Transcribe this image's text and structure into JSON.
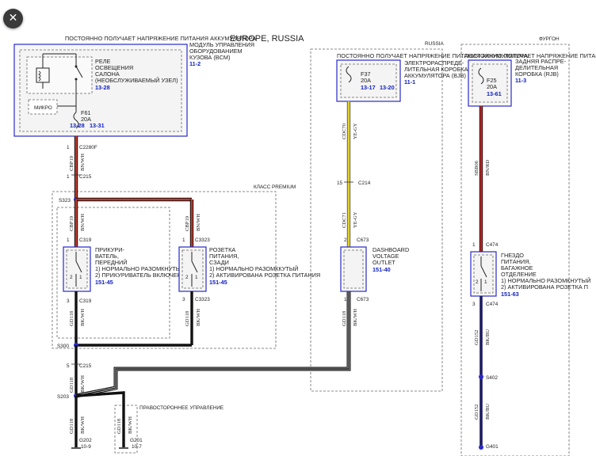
{
  "title": "EUROPE, RUSSIA",
  "close_icon": "x-close-icon",
  "headers": {
    "left_power": "ПОСТОЯННО ПОЛУЧАЕТ НАПРЯЖЕНИЕ ПИТАНИЯ АККУМУЛЯТОРА",
    "mid_power": "ПОСТОЯННО ПОЛУЧАЕТ НАПРЯЖЕНИЕ ПИТАНИЯ АККУМУЛЯТОРА",
    "right_power": "ПОСТОЯННО ПОЛУЧАЕТ НАПРЯЖЕНИЕ ПИТАНИЯ АККУМУЛЯТОРА",
    "russia": "RUSSIA",
    "van": "ФУРГОН",
    "premium": "КЛАСС PREMIUM",
    "rhd": "ПРАВОСТОРОННЕЕ УПРАВЛЕНИЕ"
  },
  "bcm": {
    "l1": "МОДУЛЬ УПРАВЛЕНИЯ",
    "l2": "ОБОРУДОВАНИЕМ",
    "l3": "КУЗОВА (BCM)",
    "ref": "11-2",
    "relay_l1": "РЕЛЕ",
    "relay_l2": "ОСВЕЩЕНИЯ",
    "relay_l3": "САЛОНА",
    "relay_l4": "(НЕОБСЛУЖИВАЕМЫЙ УЗЕЛ)",
    "relay_ref": "13-28",
    "micro": "МИКРО",
    "fuse": "F61",
    "amps": "20A",
    "ref_a": "13-28",
    "ref_b": "13-31"
  },
  "bjb": {
    "l1": "ЭЛЕКТРОРАСПРЕДЕ-",
    "l2": "ЛИТЕЛЬНАЯ КОРОБКА",
    "l3": "АККУМУЛЯТОРА (BJB)",
    "ref": "11-1",
    "fuse": "F37",
    "amps": "20A",
    "ref_a": "13-17",
    "ref_b": "13-20"
  },
  "rjb": {
    "l1": "ЗАДНЯЯ РАСПРЕ-",
    "l2": "ДЕЛИТЕЛЬНАЯ",
    "l3": "КОРОБКА (RJB)",
    "ref": "11-3",
    "fuse": "F25",
    "amps": "20A",
    "ref_a": "13-61"
  },
  "lighter": {
    "l1": "ПРИКУРИ-",
    "l2": "ВАТЕЛЬ,",
    "l3": "ПЕРЕДНИЙ",
    "s1": "1) НОРМАЛЬНО РАЗОМКНУТЫЙ",
    "s2": "2) ПРИКУРИВАТЕЛЬ ВКЛЮЧЕН",
    "ref": "151-45",
    "c_top": "C319",
    "c_bot": "C319",
    "pin_top": "1",
    "pin_bot": "3"
  },
  "rear_socket": {
    "l1": "РОЗЕТКА",
    "l2": "ПИТАНИЯ,",
    "l3": "СЗАДИ",
    "s1": "1) НОРМАЛЬНО РАЗОМККУТЫЙ",
    "s2": "2) АКТИВИРОВАНА РОЗЕТКА ПИТАНИЯ",
    "ref": "151-45",
    "c_top": "C3323",
    "c_bot": "C3323",
    "pin_top": "1",
    "pin_bot": "3"
  },
  "dash_outlet": {
    "l1": "DASHBOARD",
    "l2": "VOLTAGE",
    "l3": "OUTLET",
    "ref": "151-40",
    "c_top": "C673",
    "c_bot": "C673",
    "pin_top": "2",
    "pin_bot": "1"
  },
  "cargo_socket": {
    "l1": "ГНЕЗДО",
    "l2": "ПИТАНИЯ,",
    "l3": "БАГАЖНОЕ",
    "l4": "ОТДЕЛЕНИЕ",
    "s1": "1) НОРМАЛЬНО РАЗОМКНУТЫЙ",
    "s2": "2) АКТИВИРОВАНА РОЗЕТКА П",
    "ref": "151-63",
    "c_top": "C474",
    "c_bot": "C474",
    "pin_top": "1",
    "pin_bot": "3"
  },
  "connectors": {
    "c2280f": "C2280F",
    "c2280f_pin": "1",
    "c215_top": "C215",
    "c215_top_pin": "1",
    "c215_bot": "C215",
    "c215_bot_pin": "5",
    "c214": "C214",
    "c214_pin": "15",
    "s323": "S323",
    "s300": "S300",
    "s203": "S203",
    "s402": "S402",
    "g202": "G202",
    "g202_ref": "10-9",
    "g201": "G201",
    "g201_ref": "10-7",
    "g401": "G401"
  },
  "wires": {
    "w1_code": "CBP19",
    "w1_color": "BN/WH",
    "w2_code": "CBP19",
    "w2_color": "BN/WH",
    "w3_code": "CBP19",
    "w3_color": "BN/WH",
    "w4_code": "CBP19",
    "w4_color": "BN/WH",
    "w5_code": "GD118",
    "w5_color": "BK/WH",
    "w6_code": "GD118",
    "w6_color": "BK/WH",
    "w7_code": "GD118",
    "w7_color": "BK/WH",
    "w8_code": "GD118",
    "w8_color": "BK/WH",
    "w9_code": "GD118",
    "w9_color": "BK/WH",
    "w10_code": "GD118",
    "w10_color": "BK/WH",
    "y1_code": "CDC70",
    "y1_color": "YE-GY",
    "y2_code": "CDC71",
    "y2_color": "YE-GY",
    "r1_code": "SBB06",
    "r1_color": "BN/RD",
    "b1_code": "GD152",
    "b1_color": "BK/BU",
    "b2_code": "GD152",
    "b2_color": "BK/BU"
  },
  "colors": {
    "blue_box": "#2a2acc",
    "wire_brown": "#b8322a",
    "wire_yellow": "#dccc24",
    "wire_red": "#c52424",
    "wire_navy": "#1c1c60",
    "wire_black": "#111111",
    "ref_blue": "#1020c0"
  }
}
